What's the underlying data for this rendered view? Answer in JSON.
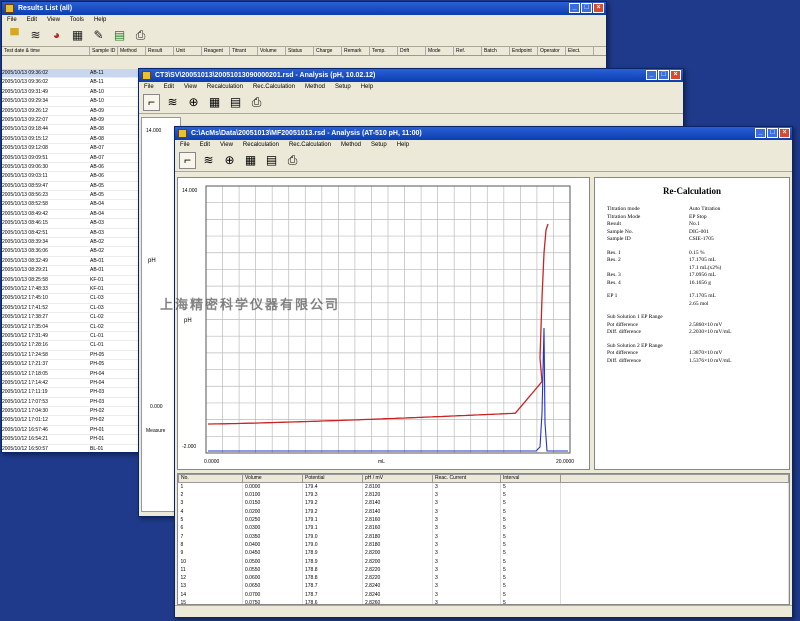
{
  "win1": {
    "title": "Results List (all)",
    "menu": [
      "File",
      "Edit",
      "View",
      "Tools",
      "Help"
    ],
    "col_headers": [
      "Test date & time",
      "Sample ID",
      "Method",
      "Result",
      "Unit",
      "Reagent",
      "Titrant",
      "Volume",
      "Status",
      "Charge",
      "Remark",
      "Temp.",
      "Drift",
      "Mode",
      "Ref.",
      "Batch",
      "Endpoint",
      "Operator",
      "Elect."
    ],
    "dates": [
      "2005/10/13 09:36:02",
      "2005/10/13 09:36:02",
      "2005/10/13 09:31:49",
      "2005/10/13 09:29:34",
      "2005/10/13 09:26:12",
      "2005/10/13 09:22:07",
      "2005/10/13 09:18:44",
      "2005/10/13 09:15:12",
      "2005/10/13 09:12:08",
      "2005/10/13 09:09:51",
      "2005/10/13 09:06:30",
      "2005/10/13 09:03:11",
      "2005/10/13 08:59:47",
      "2005/10/13 08:56:23",
      "2005/10/13 08:52:58",
      "2005/10/13 08:49:42",
      "2005/10/13 08:46:15",
      "2005/10/13 08:42:51",
      "2005/10/13 08:39:34",
      "2005/10/13 08:36:06",
      "2005/10/13 08:32:49",
      "2005/10/13 08:29:21",
      "2005/10/13 08:25:58",
      "2005/10/12 17:48:33",
      "2005/10/12 17:45:10",
      "2005/10/12 17:41:52",
      "2005/10/12 17:38:27",
      "2005/10/12 17:35:04",
      "2005/10/12 17:31:49",
      "2005/10/12 17:28:16",
      "2005/10/12 17:24:58",
      "2005/10/12 17:21:37",
      "2005/10/12 17:18:05",
      "2005/10/12 17:14:42",
      "2005/10/12 17:11:19",
      "2005/10/12 17:07:53",
      "2005/10/12 17:04:30",
      "2005/10/12 17:01:12",
      "2005/10/12 16:57:46",
      "2005/10/12 16:54:21",
      "2005/10/12 16:50:57",
      "2005/10/12 16:47:33",
      "2005/10/12 16:44:09"
    ],
    "ids": [
      "AB-11",
      "AB-11",
      "AB-10",
      "AB-10",
      "AB-09",
      "AB-09",
      "AB-08",
      "AB-08",
      "AB-07",
      "AB-07",
      "AB-06",
      "AB-06",
      "AB-05",
      "AB-05",
      "AB-04",
      "AB-04",
      "AB-03",
      "AB-03",
      "AB-02",
      "AB-02",
      "AB-01",
      "AB-01",
      "KF-01",
      "KF-01",
      "CL-03",
      "CL-03",
      "CL-02",
      "CL-02",
      "CL-01",
      "CL-01",
      "PH-05",
      "PH-05",
      "PH-04",
      "PH-04",
      "PH-03",
      "PH-03",
      "PH-02",
      "PH-02",
      "PH-01",
      "PH-01",
      "BL-01",
      "BL-01",
      "BL-00"
    ]
  },
  "win2": {
    "title": "CT3\\SV\\20051013\\20051013090000201.rsd - Analysis (pH, 10.02.12)",
    "menu": [
      "File",
      "Edit",
      "View",
      "Recalculation",
      "Rec.Calculation",
      "Method",
      "Setup",
      "Help"
    ],
    "axis_top": "14.000",
    "axis_mid": "pH",
    "axis_low": "0.000",
    "small_title": "Measure"
  },
  "win3": {
    "title": "C:\\AcMs\\Data\\20051013\\MF20051013.rsd - Analysis (AT-510 pH, 11:00)",
    "menu": [
      "File",
      "Edit",
      "View",
      "Recalculation",
      "Rec.Calculation",
      "Method",
      "Setup",
      "Help"
    ],
    "plot": {
      "y_top": "14.000",
      "y_bottom": "-2.000",
      "y_label": "pH",
      "x_left": "0.0000",
      "x_right": "20.0000",
      "x_label": "mL"
    },
    "calc": {
      "heading": "Re-Calculation",
      "block1": [
        [
          "Titration mode",
          "Auto Titration"
        ],
        [
          "Titration Mode",
          "EP Stop"
        ],
        [
          "Result",
          "No.1"
        ],
        [
          "Sample No.",
          "DIG-001"
        ],
        [
          "Sample ID",
          "CSIE-1705"
        ]
      ],
      "block2": [
        [
          "Res. 1",
          "0.15 %"
        ],
        [
          "Res. 2",
          "17.1705 mL"
        ],
        [
          "",
          "17.1 mL(x2%)"
        ],
        [
          "Res. 3",
          "17.0956 mL"
        ],
        [
          "Res. 4",
          "16.1656 g"
        ]
      ],
      "block3": [
        [
          "EP 1",
          "17.1705 mL"
        ],
        [
          "",
          "2.65 mol"
        ]
      ],
      "block4": [
        [
          "Sub Solution 1 EP Range",
          ""
        ],
        [
          "Pot difference",
          "2.5860×10 mV"
        ],
        [
          "Diff. difference",
          "2.2030×10 mV/mL"
        ]
      ],
      "block5": [
        [
          "Sub Solution 2 EP Range",
          ""
        ],
        [
          "Pot difference",
          "1.3870×10 mV"
        ],
        [
          "Diff. difference",
          "1.5376×10 mV/mL"
        ]
      ]
    },
    "table": {
      "headers": [
        "No.",
        "Volume",
        "Potential",
        "pH / mV",
        "Reac. Current",
        "Interval"
      ],
      "rows": [
        [
          "1",
          "0.0000",
          "179.4",
          "2.8100",
          "3",
          "5"
        ],
        [
          "2",
          "0.0100",
          "179.3",
          "2.8120",
          "3",
          "5"
        ],
        [
          "3",
          "0.0150",
          "179.2",
          "2.8140",
          "3",
          "5"
        ],
        [
          "4",
          "0.0200",
          "179.2",
          "2.8140",
          "3",
          "5"
        ],
        [
          "5",
          "0.0250",
          "179.1",
          "2.8160",
          "3",
          "5"
        ],
        [
          "6",
          "0.0300",
          "179.1",
          "2.8160",
          "3",
          "5"
        ],
        [
          "7",
          "0.0350",
          "179.0",
          "2.8180",
          "3",
          "5"
        ],
        [
          "8",
          "0.0400",
          "179.0",
          "2.8180",
          "3",
          "5"
        ],
        [
          "9",
          "0.0450",
          "178.9",
          "2.8200",
          "3",
          "5"
        ],
        [
          "10",
          "0.0500",
          "178.9",
          "2.8200",
          "3",
          "5"
        ],
        [
          "11",
          "0.0550",
          "178.8",
          "2.8220",
          "3",
          "5"
        ],
        [
          "12",
          "0.0600",
          "178.8",
          "2.8220",
          "3",
          "5"
        ],
        [
          "13",
          "0.0650",
          "178.7",
          "2.8240",
          "3",
          "5"
        ],
        [
          "14",
          "0.0700",
          "178.7",
          "2.8240",
          "3",
          "5"
        ],
        [
          "15",
          "0.0750",
          "178.6",
          "2.8260",
          "3",
          "5"
        ],
        [
          "16",
          "0.0800",
          "178.6",
          "2.8260",
          "3",
          "5"
        ]
      ]
    }
  },
  "watermark": "上海精密科学仪器有限公司",
  "colors": {
    "desktop": "#1f3a8a",
    "curve": "#cc2222",
    "derivative": "#2233cc"
  }
}
